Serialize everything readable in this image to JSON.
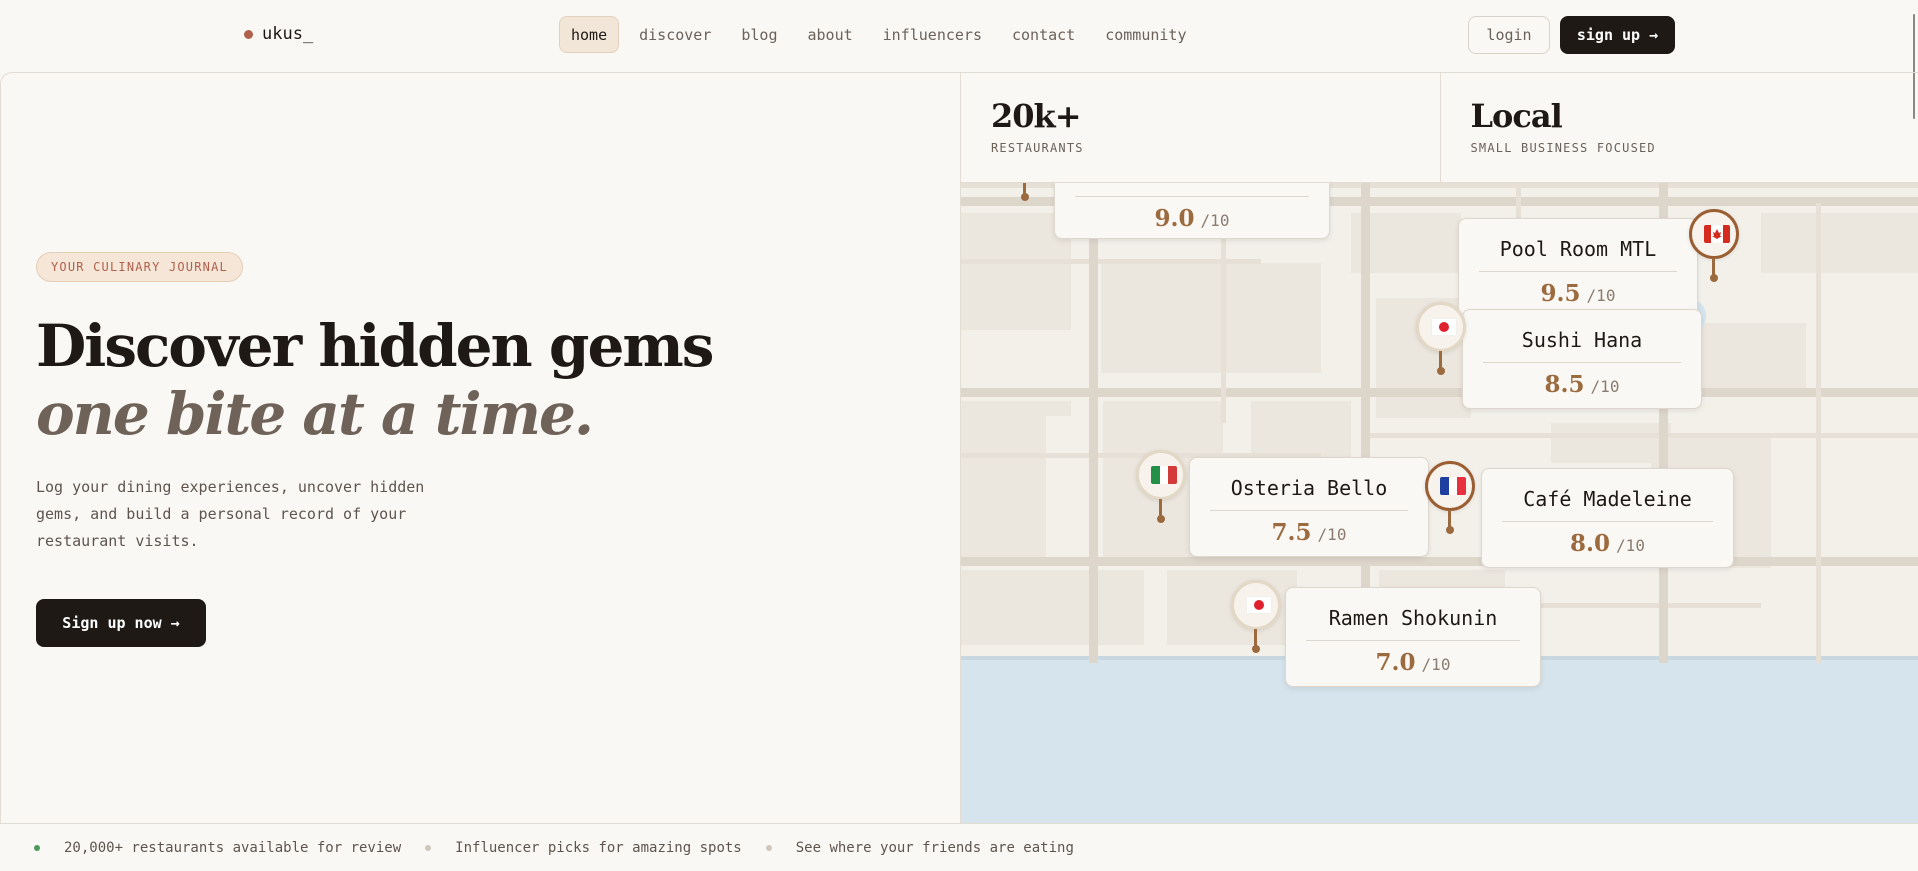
{
  "nav": {
    "logo": "ukus_",
    "links": [
      "home",
      "discover",
      "blog",
      "about",
      "influencers",
      "contact",
      "community"
    ],
    "active": "home",
    "login": "login",
    "signup": "sign up →"
  },
  "hero": {
    "tag": "YOUR CULINARY JOURNAL",
    "title_line1": "Discover hidden gems",
    "title_line2": "one bite at a time.",
    "description": "Log your dining experiences, uncover hidden gems, and build a personal record of your restaurant visits.",
    "cta": "Sign up now →"
  },
  "stats": [
    {
      "value": "20k+",
      "label": "RESTAURANTS"
    },
    {
      "value": "Local",
      "label": "SMALL BUSINESS FOCUSED"
    }
  ],
  "map": {
    "score_suffix": "/10",
    "restaurants": [
      {
        "name": "",
        "score": "9.0",
        "flag": "",
        "pin_active": false
      },
      {
        "name": "Pool Room MTL",
        "score": "9.5",
        "flag": "canada-flag-icon",
        "pin_active": true
      },
      {
        "name": "Sushi Hana",
        "score": "8.5",
        "flag": "japan-flag-icon",
        "pin_active": false
      },
      {
        "name": "Osteria Bello",
        "score": "7.5",
        "flag": "italy-flag-icon",
        "pin_active": false
      },
      {
        "name": "Café Madeleine",
        "score": "8.0",
        "flag": "france-flag-icon",
        "pin_active": true
      },
      {
        "name": "Ramen Shokunin",
        "score": "7.0",
        "flag": "japan-flag-icon",
        "pin_active": false
      }
    ]
  },
  "ticker": [
    {
      "text": "20,000+ restaurants available for review",
      "dot": "green"
    },
    {
      "text": "Influencer picks for amazing spots",
      "dot": "grey"
    },
    {
      "text": "See where your friends are eating",
      "dot": "grey"
    }
  ],
  "colors": {
    "background": "#faf8f4",
    "ink": "#1e1915",
    "accent": "#9b6a3f",
    "tag": "#b0614b",
    "water": "#d5e4ed"
  }
}
